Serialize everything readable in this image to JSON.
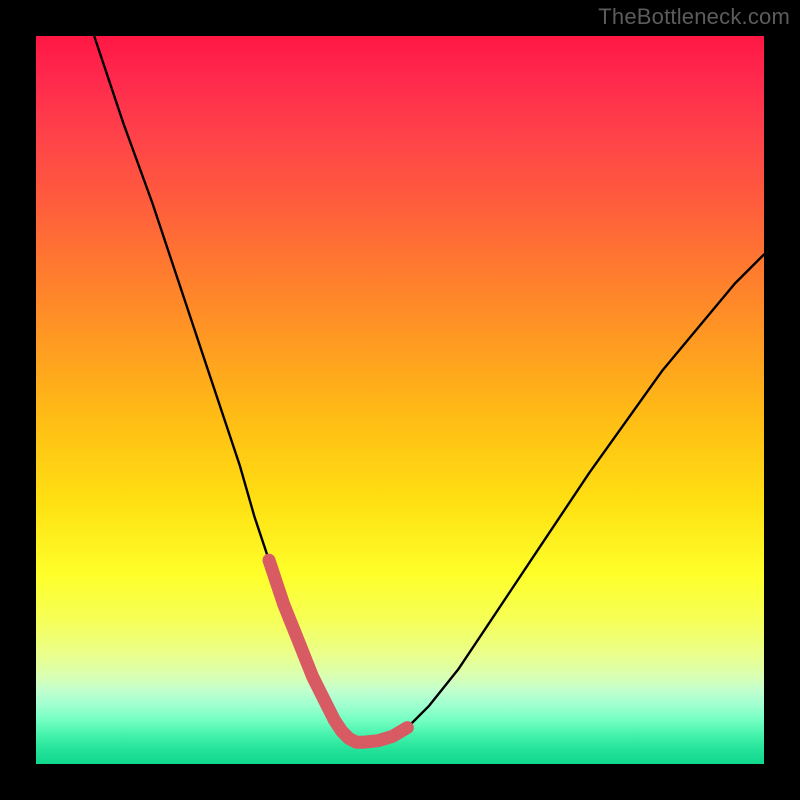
{
  "watermark": "TheBottleneck.com",
  "colors": {
    "page_bg": "#000000",
    "curve_stroke": "#000000",
    "highlight_stroke": "#d85a62",
    "gradient_stops": [
      "#ff1744",
      "#ff2a4d",
      "#ff4349",
      "#ff5a3e",
      "#ff7a2f",
      "#ff9a22",
      "#ffbb15",
      "#ffe012",
      "#feff2a",
      "#f6ff55",
      "#eaff8c",
      "#d8ffb3",
      "#c0ffcf",
      "#9dffcf",
      "#73ffc2",
      "#45f2ac",
      "#24e39a",
      "#0fd88c"
    ]
  },
  "chart_data": {
    "type": "line",
    "title": "",
    "xlabel": "",
    "ylabel": "",
    "xlim": [
      0,
      100
    ],
    "ylim": [
      0,
      100
    ],
    "grid": false,
    "legend": false,
    "note": "Abstract bottleneck-style V-curve on a thermal gradient. Values are approximate readings from curve shape; there are no numeric axis labels in the image.",
    "series": [
      {
        "name": "curve",
        "x": [
          8,
          12,
          16,
          20,
          24,
          28,
          30,
          32,
          34,
          36,
          38,
          40,
          41,
          42,
          43,
          44,
          45,
          47,
          49,
          51,
          54,
          58,
          62,
          68,
          76,
          86,
          96,
          100
        ],
        "y": [
          100,
          88,
          77,
          65,
          53,
          41,
          34,
          28,
          22,
          17,
          12,
          8,
          6,
          4.5,
          3.5,
          3,
          3,
          3.2,
          3.8,
          5,
          8,
          13,
          19,
          28,
          40,
          54,
          66,
          70
        ]
      }
    ],
    "highlight_segment": {
      "description": "thick pink stroke near the valley of the curve",
      "x": [
        32,
        34,
        36,
        38,
        40,
        41,
        42,
        43,
        44,
        45,
        47,
        49,
        51
      ],
      "y": [
        28,
        22,
        17,
        12,
        8,
        6,
        4.5,
        3.5,
        3,
        3,
        3.2,
        3.8,
        5
      ]
    }
  }
}
